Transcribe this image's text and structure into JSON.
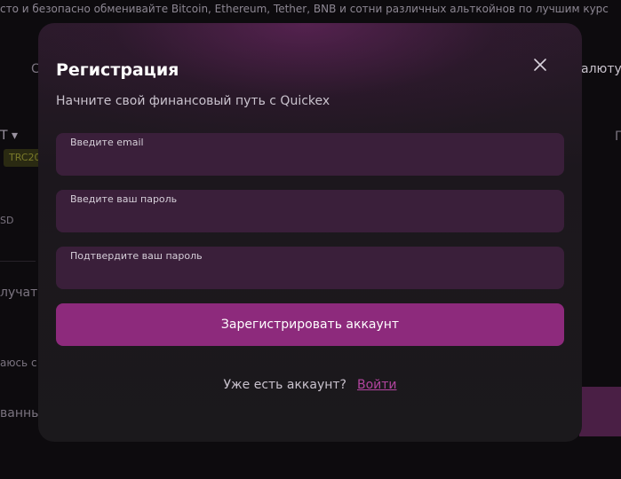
{
  "background": {
    "top_text": "сто и безопасно обменивайте Bitcoin, Ethereum, Tether, BNB и сотни различных альткойнов по лучшим курс",
    "frag_c": "С",
    "frag_currency": "алюту",
    "frag_t": "T ▾",
    "frag_badge": "TRC20",
    "frag_sd": "SD",
    "frag_p": "П",
    "frag_recipient": "лучате",
    "frag_agree": "аюсь с",
    "frag_bottom": "ванны"
  },
  "modal": {
    "title": "Регистрация",
    "subtitle": "Начните свой финансовый путь с Quickex",
    "fields": [
      {
        "label": "Введите email",
        "value": ""
      },
      {
        "label": "Введите ваш пароль",
        "value": ""
      },
      {
        "label": "Подтвердите ваш пароль",
        "value": ""
      }
    ],
    "submit_label": "Зарегистрировать аккаунт",
    "login_prompt": "Уже есть аккаунт?",
    "login_link": "Войти",
    "icons": {
      "close": "close-icon"
    },
    "colors": {
      "accent": "#8d2a7c",
      "link": "#b2449f",
      "field_bg": "#3a1f3a"
    }
  }
}
